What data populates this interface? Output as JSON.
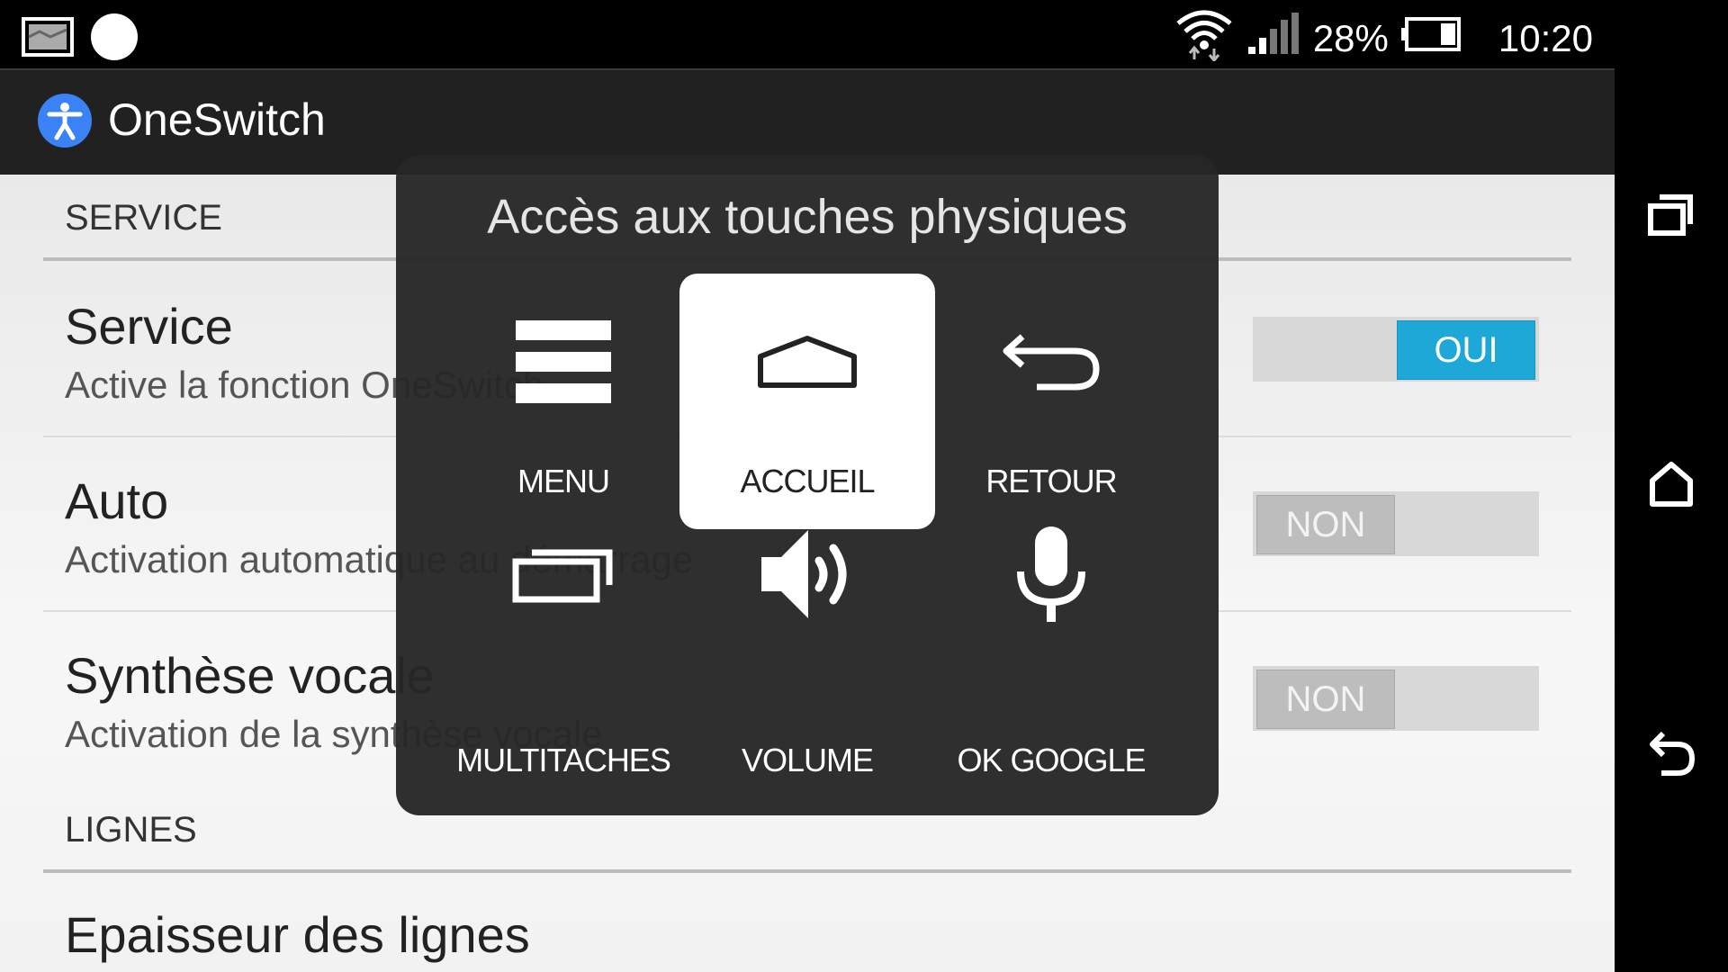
{
  "status_bar": {
    "battery": "28%",
    "time": "10:20",
    "icons": [
      "image-notification-icon",
      "circle-notification-icon",
      "wifi-icon",
      "signal-icon",
      "battery-icon"
    ]
  },
  "app_bar": {
    "title": "OneSwitch",
    "icon": "accessibility-icon",
    "icon_color": "#3b82f6"
  },
  "settings": {
    "service_header": "SERVICE",
    "rows": [
      {
        "title": "Service",
        "subtitle": "Active la fonction OneSwitch",
        "toggle": "OUI",
        "on": true
      },
      {
        "title": "Auto",
        "subtitle": "Activation automatique au démarrage",
        "toggle": "NON",
        "on": false
      },
      {
        "title": "Synthèse vocale",
        "subtitle": "Activation de la synthèse vocale",
        "toggle": "NON",
        "on": false
      }
    ],
    "lines_header": "LIGNES",
    "lines_row": {
      "title": "Epaisseur des lignes"
    }
  },
  "overlay": {
    "title": "Accès aux touches physiques",
    "keys": [
      {
        "label": "MENU",
        "icon": "menu-icon",
        "active": false
      },
      {
        "label": "ACCUEIL",
        "icon": "home-icon",
        "active": true
      },
      {
        "label": "RETOUR",
        "icon": "back-icon",
        "active": false
      },
      {
        "label": "MULTITACHES",
        "icon": "multitask-icon",
        "active": false
      },
      {
        "label": "VOLUME",
        "icon": "volume-icon",
        "active": false
      },
      {
        "label": "OK GOOGLE",
        "icon": "microphone-icon",
        "active": false
      }
    ]
  },
  "nav_bar": {
    "buttons": [
      "recent-apps-icon",
      "home-icon",
      "back-icon"
    ]
  },
  "colors": {
    "toggle_on": "#1da8d8",
    "toggle_off": "#bdbdbd",
    "overlay_bg": "#262626"
  }
}
